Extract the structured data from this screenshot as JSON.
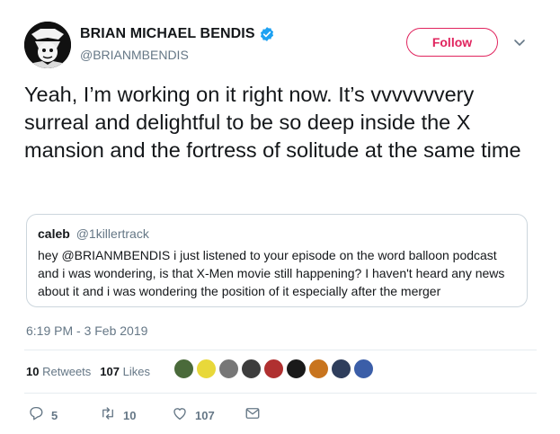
{
  "author": {
    "display_name": "BRIAN MICHAEL BENDIS",
    "handle": "@BRIANMBENDIS",
    "verified": true,
    "verified_color": "#1da1f2"
  },
  "follow_button": {
    "label": "Follow",
    "color": "#e0245e"
  },
  "tweet": {
    "text": "Yeah, I’m working on it right now. It’s vvvvvvvery surreal and delightful to be so deep inside the X mansion and the fortress of solitude at the same time"
  },
  "quoted_tweet": {
    "name": "caleb",
    "handle": "@1killertrack",
    "text": "hey @BRIANMBENDIS i just listened to your episode on the word balloon podcast and i was wondering, is that X-Men movie still happening?  I haven't heard any news about it and i was wondering the position of it especially after the merger"
  },
  "timestamp": "6:19 PM - 3 Feb 2019",
  "stats": {
    "retweets_count": "10",
    "retweets_label": "Retweets",
    "likes_count": "107",
    "likes_label": "Likes"
  },
  "likers": [
    {
      "name": "liker-1",
      "color": "#4a6a3a"
    },
    {
      "name": "liker-2",
      "color": "#e8d83a"
    },
    {
      "name": "liker-3",
      "color": "#777777"
    },
    {
      "name": "liker-4",
      "color": "#3d3d3d"
    },
    {
      "name": "liker-5",
      "color": "#b03030"
    },
    {
      "name": "liker-6",
      "color": "#1a1a1a"
    },
    {
      "name": "liker-7",
      "color": "#c8741e"
    },
    {
      "name": "liker-8",
      "color": "#2f3e5c"
    },
    {
      "name": "liker-9",
      "color": "#3b5ea8"
    }
  ],
  "actions": {
    "reply_count": "5",
    "retweet_count": "10",
    "like_count": "107",
    "icon_color": "#657786"
  }
}
